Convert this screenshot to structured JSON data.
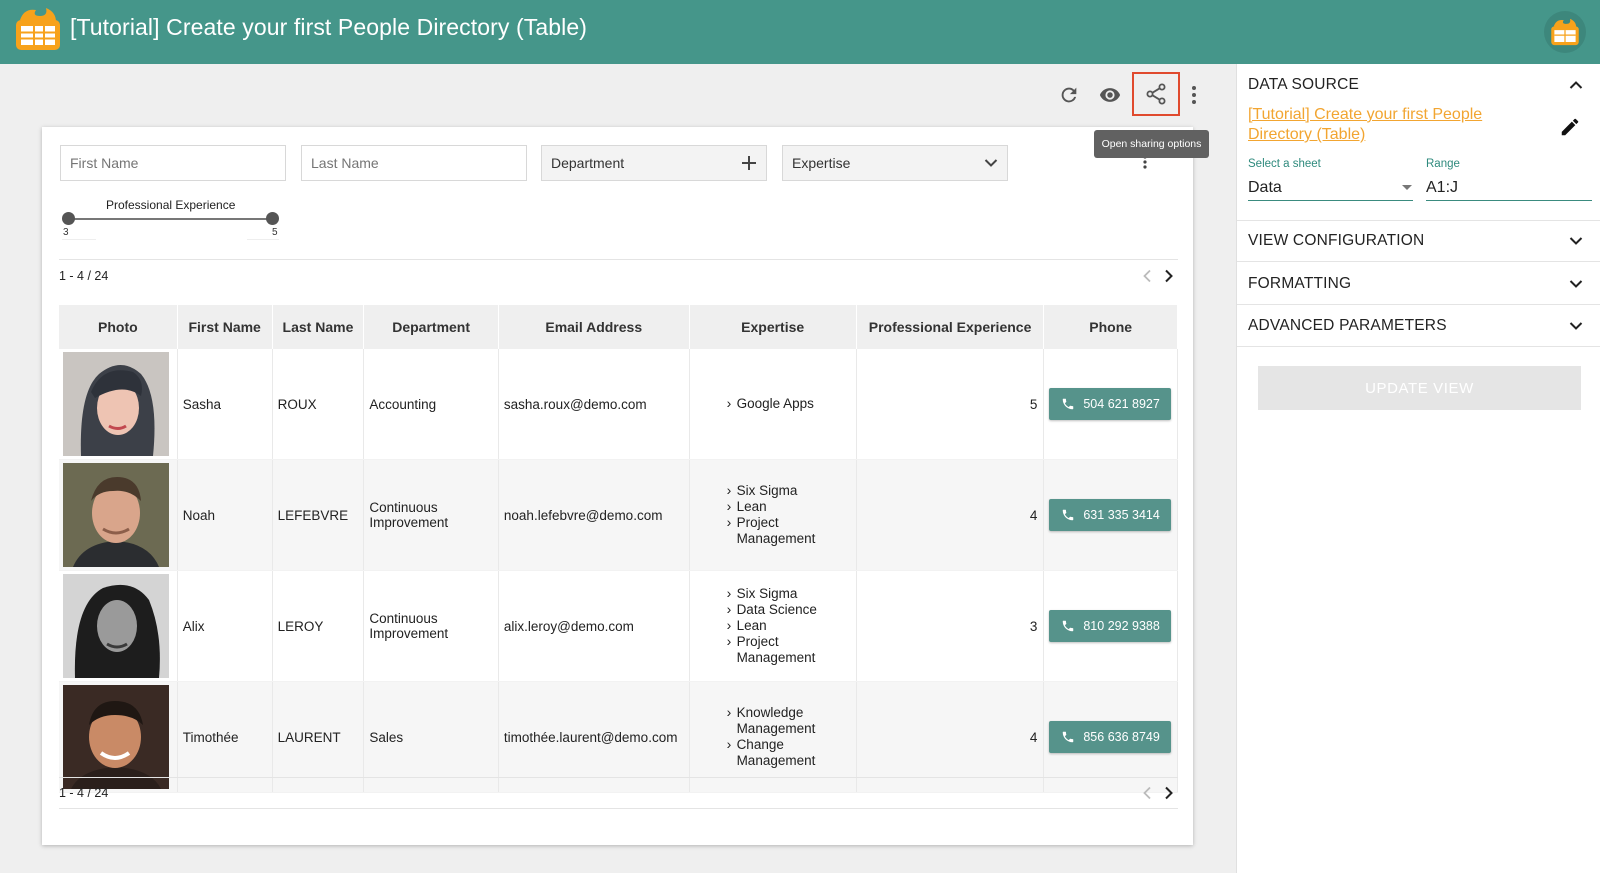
{
  "header": {
    "title": "[Tutorial] Create your first People Directory (Table)"
  },
  "toolbar": {
    "refresh_icon": "refresh-icon",
    "preview_icon": "eye-icon",
    "share_icon": "share-icon",
    "menu_icon": "more-vert-icon",
    "tooltip": "Open sharing options"
  },
  "filters": {
    "first_name_placeholder": "First Name",
    "last_name_placeholder": "Last Name",
    "department_label": "Department",
    "expertise_label": "Expertise",
    "slider": {
      "label": "Professional Experience",
      "min_value": "3",
      "max_value": "5"
    }
  },
  "pagination": {
    "label": "1 - 4 / 24"
  },
  "table": {
    "columns": [
      "Photo",
      "First Name",
      "Last Name",
      "Department",
      "Email Address",
      "Expertise",
      "Professional Experience",
      "Phone"
    ],
    "rows": [
      {
        "first_name": "Sasha",
        "last_name": "ROUX",
        "department": "Accounting",
        "email": "sasha.roux@demo.com",
        "expertise": [
          "Google Apps"
        ],
        "experience": "5",
        "phone": "504 621 8927"
      },
      {
        "first_name": "Noah",
        "last_name": "LEFEBVRE",
        "department": "Continuous Improvement",
        "email": "noah.lefebvre@demo.com",
        "expertise": [
          "Six Sigma",
          "Lean",
          "Project Management"
        ],
        "experience": "4",
        "phone": "631 335 3414"
      },
      {
        "first_name": "Alix",
        "last_name": "LEROY",
        "department": "Continuous Improvement",
        "email": "alix.leroy@demo.com",
        "expertise": [
          "Six Sigma",
          "Data Science",
          "Lean",
          "Project Management"
        ],
        "experience": "3",
        "phone": "810 292 9388"
      },
      {
        "first_name": "Timothée",
        "last_name": "LAURENT",
        "department": "Sales",
        "email": "timothée.laurent@demo.com",
        "expertise": [
          "Knowledge Management",
          "Change Management"
        ],
        "experience": "4",
        "phone": "856 636 8749"
      }
    ]
  },
  "panel": {
    "data_source": {
      "title": "DATA SOURCE",
      "link": "[Tutorial] Create your first People Directory (Table)",
      "sheet_label": "Select a sheet",
      "sheet_value": "Data",
      "range_label": "Range",
      "range_value": "A1:J"
    },
    "sections": [
      "VIEW CONFIGURATION",
      "FORMATTING",
      "ADVANCED PARAMETERS"
    ],
    "update_button": "UPDATE VIEW"
  },
  "colors": {
    "header": "#45968a",
    "accent": "#3a8b7f",
    "link": "#f2a531",
    "phone_button": "#56938b",
    "highlight": "#e04a2e"
  }
}
